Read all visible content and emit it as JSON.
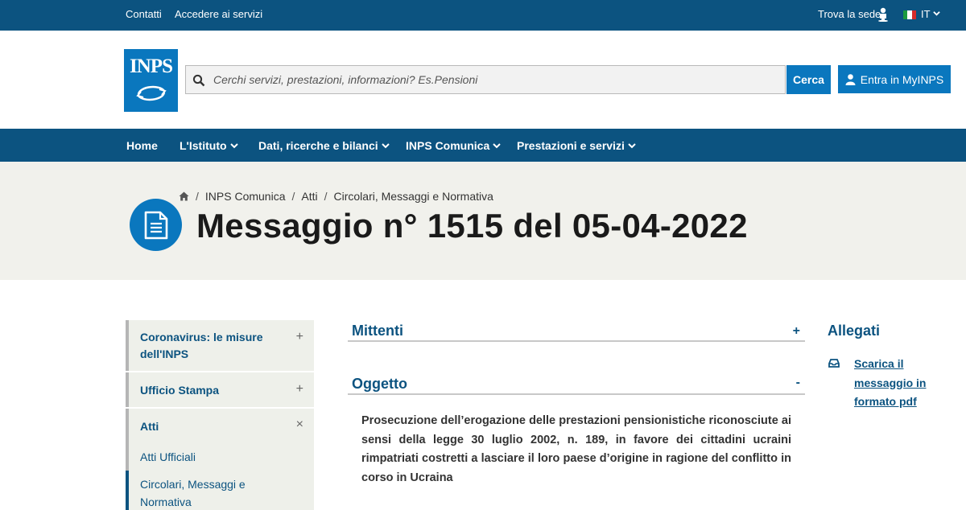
{
  "topbar": {
    "contatti": "Contatti",
    "accedere": "Accedere ai servizi",
    "trova_sede": "Trova la sede",
    "language": "IT"
  },
  "header": {
    "logo_text": "INPS",
    "search_placeholder": "Cerchi servizi, prestazioni, informazioni? Es.Pensioni",
    "search_value": "",
    "search_button": "Cerca",
    "myinps_button": "Entra in MyINPS"
  },
  "nav": {
    "items": [
      {
        "label": "Home"
      },
      {
        "label": "L'Istituto"
      },
      {
        "label": "Dati, ricerche e bilanci"
      },
      {
        "label": "INPS Comunica"
      },
      {
        "label": "Prestazioni e servizi"
      }
    ]
  },
  "breadcrumb": [
    "INPS Comunica",
    "Atti",
    "Circolari, Messaggi e Normativa"
  ],
  "page_title": "Messaggio n° 1515 del 05-04-2022",
  "sidebar": {
    "items": [
      {
        "label_line1": "Coronavirus: le misure",
        "label_line2": "dell'INPS",
        "sign": "+"
      },
      {
        "label": "Ufficio Stampa",
        "sign": "+"
      },
      {
        "label": "Atti",
        "sign": "×"
      }
    ],
    "subitems": [
      {
        "label": "Atti Ufficiali"
      },
      {
        "label_line1": "Circolari, Messaggi e",
        "label_line2": "Normativa"
      }
    ]
  },
  "main": {
    "mittenti": {
      "title": "Mittenti",
      "sign": "+"
    },
    "oggetto": {
      "title": "Oggetto",
      "sign": "-",
      "text": "Prosecuzione dell’erogazione delle prestazioni pensionistiche riconosciute ai sensi della legge 30 luglio 2002, n. 189, in favore dei cittadini ucraini rimpatriati costretti a lasciare il loro paese d’origine in ragione del conflitto in corso in Ucraina"
    }
  },
  "allegati": {
    "title": "Allegati",
    "link": "Scarica il messaggio in formato pdf"
  },
  "colors": {
    "brand_dark": "#0c5380",
    "brand": "#0a77be",
    "hero_bg": "#f1f1ec"
  },
  "icons": {
    "user": "person-icon",
    "search": "search-icon",
    "home": "home-icon",
    "document": "document-icon",
    "download": "inbox-download-icon"
  }
}
